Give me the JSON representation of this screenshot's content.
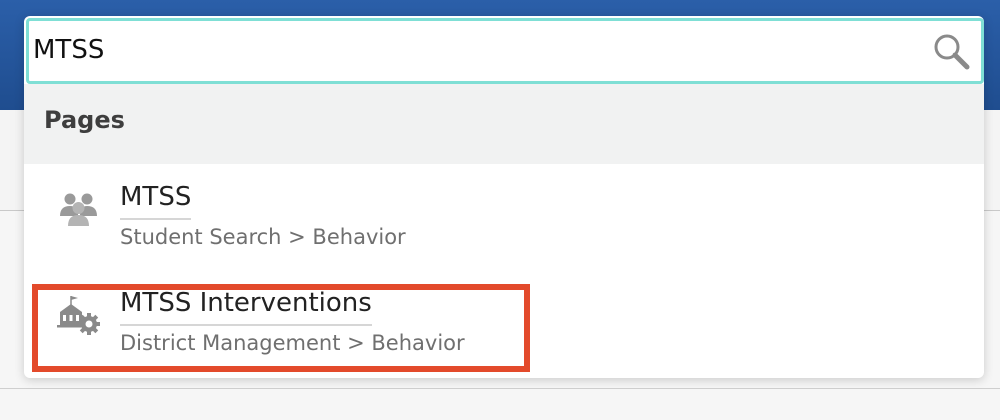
{
  "search": {
    "value": "MTSS",
    "icon": "magnifier-icon"
  },
  "sections": [
    {
      "title": "Pages",
      "results": [
        {
          "title": "MTSS",
          "path": "Student Search > Behavior",
          "icon": "people-group-icon"
        },
        {
          "title": "MTSS Interventions",
          "path": "District Management > Behavior",
          "icon": "school-gear-icon",
          "highlighted": true
        }
      ]
    }
  ],
  "colors": {
    "header_blue": "#2458a0",
    "search_focus_border": "#7fdfd5",
    "highlight_red": "#e34a2b",
    "section_header_bg": "#f1f2f2",
    "path_text": "#6f6f6f",
    "icon_gray": "#9a9a9a"
  }
}
